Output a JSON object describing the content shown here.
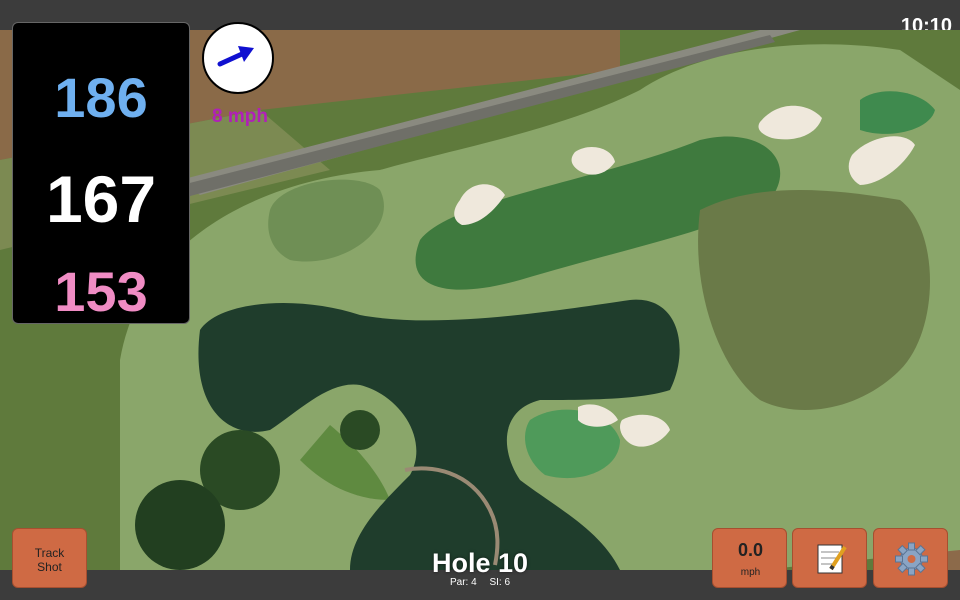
{
  "status_bar": {
    "time": "10:10"
  },
  "distances": {
    "back": "186",
    "middle": "167",
    "front": "153"
  },
  "wind": {
    "speed_label": "8 mph",
    "direction_icon": "arrow-right-icon"
  },
  "hole": {
    "title": "Hole 10",
    "par": "Par: 4",
    "stroke_index": "SI: 6"
  },
  "buttons": {
    "track_shot_line1": "Track",
    "track_shot_line2": "Shot",
    "speed_value": "0.0",
    "speed_unit": "mph",
    "notes_icon": "notepad-icon",
    "settings_icon": "gear-icon"
  },
  "colors": {
    "back_distance": "#6fb0f0",
    "middle_distance": "#ffffff",
    "front_distance": "#f08cc4",
    "wind_label": "#b020b8",
    "button": "#cf6a44"
  }
}
